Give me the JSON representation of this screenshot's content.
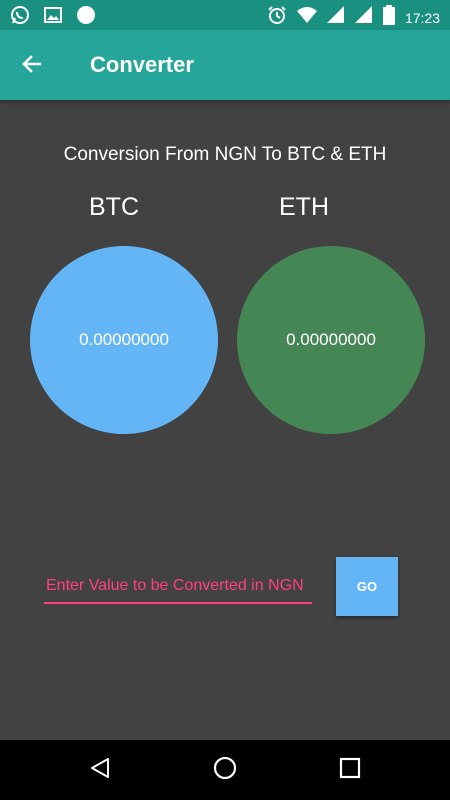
{
  "status_bar": {
    "time": "17:23",
    "left_icons": [
      "whatsapp-icon",
      "image-icon",
      "circle-icon"
    ],
    "right_icons": [
      "alarm-icon",
      "wifi-icon",
      "signal-icon",
      "signal-r-icon",
      "battery-icon"
    ]
  },
  "app_bar": {
    "title": "Converter",
    "back_icon": "arrow-back-icon",
    "background": "#26a69a"
  },
  "main": {
    "heading": "Conversion From NGN To BTC & ETH",
    "btc": {
      "label": "BTC",
      "value": "0.00000000",
      "color": "#64b5f6"
    },
    "eth": {
      "label": "ETH",
      "value": "0.00000000",
      "color": "#458754"
    },
    "input": {
      "placeholder": "Enter Value to be Converted in NGN",
      "value": ""
    },
    "go_label": "GO"
  },
  "nav_bar": {
    "icons": [
      "nav-back-icon",
      "nav-home-icon",
      "nav-recents-icon"
    ]
  }
}
